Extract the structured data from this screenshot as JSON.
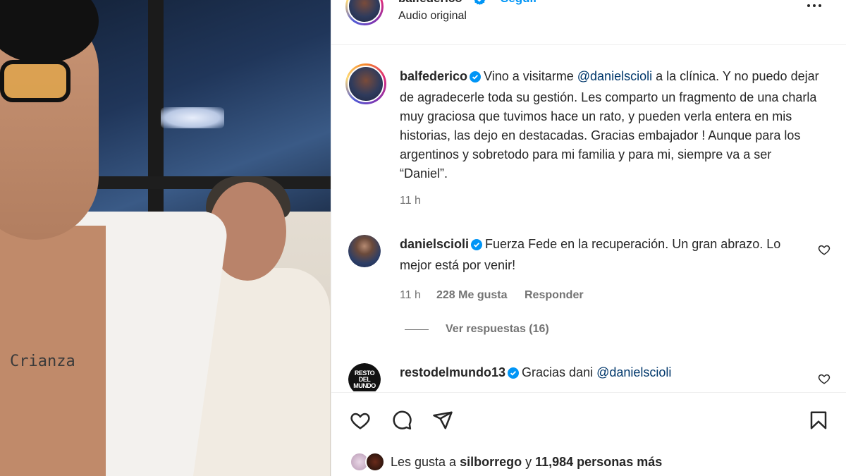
{
  "post": {
    "username": "balfederico",
    "follow_label": "Seguir",
    "subtitle": "Audio original"
  },
  "media": {
    "tattoo_text": "Crianza"
  },
  "caption": {
    "username": "balfederico",
    "text_before_mention": "Vino a visitarme ",
    "mention": "@danielscioli",
    "text_after_mention": " a la clínica. Y no puedo dejar de agradecerle toda su gestión. Les comparto un fragmento de una charla muy graciosa que tuvimos hace un rato, y pueden verla entera en mis historias, las dejo en destacadas. Gracias embajador ! Aunque para los argentinos y sobretodo para mi familia y para mi, siempre va a ser “Daniel”.",
    "time": "11 h"
  },
  "comments": [
    {
      "username": "danielscioli",
      "text": "Fuerza Fede en la recuperación. Un gran abrazo. Lo mejor está por venir!",
      "time": "11 h",
      "likes": "228 Me gusta",
      "reply_label": "Responder",
      "view_replies": "Ver respuestas (16)"
    },
    {
      "username": "restodelmundo13",
      "text_before_mention": "Gracias dani ",
      "mention": "@danielscioli",
      "avatar_text": "RESTO DEL MUNDO"
    }
  ],
  "actions": {
    "like_icon": "heart-icon",
    "comment_icon": "comment-icon",
    "share_icon": "share-icon",
    "save_icon": "bookmark-icon"
  },
  "likes": {
    "prefix": "Les gusta a ",
    "user": "silborrego",
    "middle": " y ",
    "count": "11,984 personas más"
  },
  "colors": {
    "link": "#00376b",
    "follow": "#0095f6",
    "verified": "#0095f6",
    "muted": "#737373"
  }
}
